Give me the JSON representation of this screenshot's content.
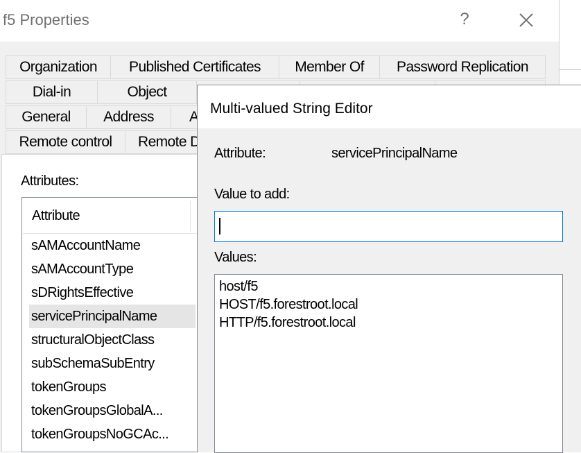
{
  "window": {
    "title": "f5 Properties",
    "help_symbol": "?"
  },
  "tabs": {
    "row1": [
      "Organization",
      "Published Certificates",
      "Member Of",
      "Password Replication"
    ],
    "row2": [
      "Dial-in",
      "Object"
    ],
    "row3": [
      "General",
      "Address",
      "A"
    ],
    "row4": [
      "Remote control",
      "Remote D"
    ]
  },
  "attribute_editor": {
    "label": "Attributes:",
    "column_header": "Attribute",
    "rows": [
      {
        "name": "sAMAccountName"
      },
      {
        "name": "sAMAccountType"
      },
      {
        "name": "sDRightsEffective"
      },
      {
        "name": "servicePrincipalName",
        "selected": true
      },
      {
        "name": "structuralObjectClass"
      },
      {
        "name": "subSchemaSubEntry"
      },
      {
        "name": "tokenGroups"
      },
      {
        "name": "tokenGroupsGlobalA..."
      },
      {
        "name": "tokenGroupsNoGCAc..."
      }
    ]
  },
  "string_editor": {
    "title": "Multi-valued String Editor",
    "attribute_label": "Attribute:",
    "attribute_value": "servicePrincipalName",
    "value_to_add_label": "Value to add:",
    "value_to_add": "",
    "values_label": "Values:",
    "values": [
      "host/f5",
      "HOST/f5.forestroot.local",
      "HTTP/f5.forestroot.local"
    ]
  },
  "colors": {
    "focus_border": "#0078d7",
    "selection": "#e5e5e5",
    "dialog_bg": "#f0f0f0"
  }
}
